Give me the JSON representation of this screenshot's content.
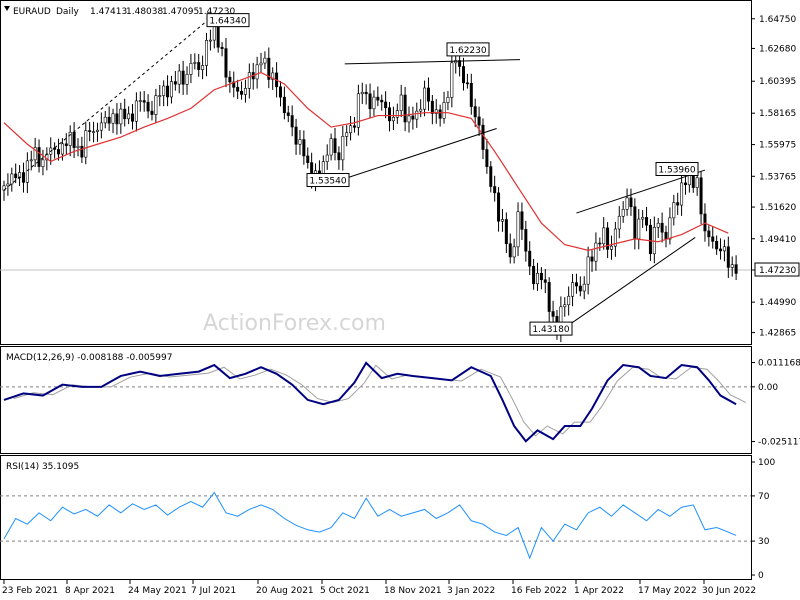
{
  "chart_data": {
    "type": "candlestick",
    "instrument": "EURAUD",
    "timeframe": "Daily",
    "ohlc": [
      "1.47413",
      "1.48038",
      "1.47095",
      "1.47230"
    ],
    "watermark": "ActionForex.com",
    "price_axis": [
      "1.64750",
      "1.62680",
      "1.60395",
      "1.58165",
      "1.55975",
      "1.53765",
      "1.51620",
      "1.49410",
      "1.47230",
      "1.44990",
      "1.42865"
    ],
    "last_price_label": "1.47230",
    "price_range": [
      1.4235,
      1.655
    ],
    "annotations": [
      {
        "text": "1.64340",
        "value": 1.6434
      },
      {
        "text": "1.62230",
        "value": 1.6223
      },
      {
        "text": "1.53540",
        "value": 1.5354
      },
      {
        "text": "1.53960",
        "value": 1.5396
      },
      {
        "text": "1.43180",
        "value": 1.4318
      }
    ],
    "price_series": [
      [
        0,
        1.528
      ],
      [
        4,
        1.54
      ],
      [
        8,
        1.535
      ],
      [
        12,
        1.545
      ],
      [
        16,
        1.555
      ],
      [
        20,
        1.545
      ],
      [
        24,
        1.56
      ],
      [
        28,
        1.552
      ],
      [
        32,
        1.565
      ],
      [
        36,
        1.56
      ],
      [
        40,
        1.555
      ],
      [
        44,
        1.572
      ],
      [
        48,
        1.568
      ],
      [
        52,
        1.58
      ],
      [
        56,
        1.575
      ],
      [
        60,
        1.583
      ],
      [
        64,
        1.576
      ],
      [
        68,
        1.588
      ],
      [
        72,
        1.59
      ],
      [
        76,
        1.58
      ],
      [
        80,
        1.6
      ],
      [
        84,
        1.594
      ],
      [
        88,
        1.608
      ],
      [
        92,
        1.603
      ],
      [
        96,
        1.617
      ],
      [
        100,
        1.612
      ],
      [
        104,
        1.627
      ],
      [
        108,
        1.643
      ],
      [
        112,
        1.62
      ],
      [
        116,
        1.603
      ],
      [
        120,
        1.595
      ],
      [
        124,
        1.6
      ],
      [
        128,
        1.61
      ],
      [
        132,
        1.618
      ],
      [
        136,
        1.612
      ],
      [
        140,
        1.6
      ],
      [
        144,
        1.585
      ],
      [
        148,
        1.57
      ],
      [
        152,
        1.56
      ],
      [
        156,
        1.545
      ],
      [
        160,
        1.535
      ],
      [
        164,
        1.548
      ],
      [
        168,
        1.56
      ],
      [
        172,
        1.552
      ],
      [
        176,
        1.57
      ],
      [
        180,
        1.575
      ],
      [
        184,
        1.602
      ],
      [
        188,
        1.585
      ],
      [
        192,
        1.595
      ],
      [
        196,
        1.582
      ],
      [
        200,
        1.578
      ],
      [
        204,
        1.59
      ],
      [
        208,
        1.575
      ],
      [
        212,
        1.582
      ],
      [
        216,
        1.595
      ],
      [
        220,
        1.585
      ],
      [
        224,
        1.578
      ],
      [
        228,
        1.598
      ],
      [
        232,
        1.622
      ],
      [
        236,
        1.605
      ],
      [
        240,
        1.59
      ],
      [
        244,
        1.57
      ],
      [
        248,
        1.545
      ],
      [
        252,
        1.52
      ],
      [
        256,
        1.505
      ],
      [
        260,
        1.478
      ],
      [
        264,
        1.51
      ],
      [
        268,
        1.488
      ],
      [
        272,
        1.462
      ],
      [
        276,
        1.472
      ],
      [
        280,
        1.445
      ],
      [
        284,
        1.432
      ],
      [
        288,
        1.45
      ],
      [
        292,
        1.462
      ],
      [
        296,
        1.458
      ],
      [
        300,
        1.475
      ],
      [
        304,
        1.49
      ],
      [
        308,
        1.496
      ],
      [
        312,
        1.488
      ],
      [
        316,
        1.51
      ],
      [
        320,
        1.523
      ],
      [
        324,
        1.5
      ],
      [
        328,
        1.51
      ],
      [
        332,
        1.49
      ],
      [
        336,
        1.505
      ],
      [
        340,
        1.495
      ],
      [
        344,
        1.518
      ],
      [
        348,
        1.528
      ],
      [
        352,
        1.539
      ],
      [
        356,
        1.53
      ],
      [
        360,
        1.5
      ],
      [
        364,
        1.49
      ],
      [
        368,
        1.488
      ],
      [
        372,
        1.478
      ],
      [
        376,
        1.472
      ]
    ],
    "moving_average": [
      [
        0,
        1.575
      ],
      [
        12,
        1.56
      ],
      [
        24,
        1.548
      ],
      [
        36,
        1.555
      ],
      [
        48,
        1.56
      ],
      [
        60,
        1.565
      ],
      [
        72,
        1.572
      ],
      [
        84,
        1.578
      ],
      [
        96,
        1.585
      ],
      [
        108,
        1.598
      ],
      [
        120,
        1.604
      ],
      [
        132,
        1.61
      ],
      [
        144,
        1.602
      ],
      [
        156,
        1.585
      ],
      [
        168,
        1.572
      ],
      [
        180,
        1.575
      ],
      [
        192,
        1.58
      ],
      [
        204,
        1.58
      ],
      [
        216,
        1.582
      ],
      [
        228,
        1.582
      ],
      [
        240,
        1.578
      ],
      [
        252,
        1.555
      ],
      [
        264,
        1.53
      ],
      [
        276,
        1.505
      ],
      [
        288,
        1.49
      ],
      [
        300,
        1.486
      ],
      [
        312,
        1.49
      ],
      [
        324,
        1.494
      ],
      [
        336,
        1.492
      ],
      [
        348,
        1.497
      ],
      [
        360,
        1.505
      ],
      [
        372,
        1.498
      ]
    ],
    "trendlines": [
      {
        "from": [
          175,
          1.616
        ],
        "to": [
          265,
          1.619
        ]
      },
      {
        "from": [
          175,
          1.536
        ],
        "to": [
          253,
          1.571
        ]
      },
      {
        "from": [
          294,
          1.512
        ],
        "to": [
          360,
          1.542
        ]
      },
      {
        "from": [
          288,
          1.432
        ],
        "to": [
          355,
          1.495
        ]
      }
    ],
    "macd": {
      "label": "MACD(12,26,9) -0.008188 -0.005997",
      "axis": [
        "0.011168",
        "0.00",
        "-0.025117"
      ],
      "range": [
        -0.029,
        0.016
      ],
      "macd_line": [
        [
          0,
          -0.006
        ],
        [
          10,
          -0.003
        ],
        [
          20,
          -0.004
        ],
        [
          30,
          0.001
        ],
        [
          40,
          0.0
        ],
        [
          50,
          0.0
        ],
        [
          60,
          0.005
        ],
        [
          70,
          0.007
        ],
        [
          80,
          0.005
        ],
        [
          90,
          0.006
        ],
        [
          100,
          0.007
        ],
        [
          108,
          0.01
        ],
        [
          116,
          0.004
        ],
        [
          124,
          0.006
        ],
        [
          132,
          0.009
        ],
        [
          140,
          0.006
        ],
        [
          148,
          0.001
        ],
        [
          156,
          -0.006
        ],
        [
          164,
          -0.008
        ],
        [
          172,
          -0.006
        ],
        [
          180,
          0.002
        ],
        [
          186,
          0.011
        ],
        [
          194,
          0.004
        ],
        [
          202,
          0.006
        ],
        [
          210,
          0.005
        ],
        [
          220,
          0.004
        ],
        [
          230,
          0.003
        ],
        [
          240,
          0.009
        ],
        [
          250,
          0.005
        ],
        [
          256,
          -0.006
        ],
        [
          262,
          -0.018
        ],
        [
          268,
          -0.025
        ],
        [
          274,
          -0.02
        ],
        [
          282,
          -0.024
        ],
        [
          288,
          -0.018
        ],
        [
          296,
          -0.018
        ],
        [
          302,
          -0.01
        ],
        [
          310,
          0.003
        ],
        [
          318,
          0.01
        ],
        [
          326,
          0.009
        ],
        [
          332,
          0.005
        ],
        [
          340,
          0.004
        ],
        [
          348,
          0.01
        ],
        [
          356,
          0.009
        ],
        [
          362,
          0.003
        ],
        [
          368,
          -0.004
        ],
        [
          376,
          -0.008
        ]
      ]
    },
    "rsi": {
      "label": "RSI(14) 35.1095",
      "axis": [
        "100",
        "70",
        "30",
        "0"
      ],
      "range": [
        0,
        100
      ],
      "levels": [
        70,
        30
      ],
      "rsi_line": [
        [
          0,
          32
        ],
        [
          6,
          50
        ],
        [
          12,
          45
        ],
        [
          18,
          55
        ],
        [
          24,
          48
        ],
        [
          30,
          60
        ],
        [
          36,
          54
        ],
        [
          42,
          58
        ],
        [
          48,
          52
        ],
        [
          54,
          62
        ],
        [
          60,
          55
        ],
        [
          66,
          63
        ],
        [
          72,
          58
        ],
        [
          78,
          62
        ],
        [
          84,
          53
        ],
        [
          90,
          60
        ],
        [
          96,
          65
        ],
        [
          102,
          60
        ],
        [
          108,
          73
        ],
        [
          114,
          55
        ],
        [
          120,
          52
        ],
        [
          126,
          58
        ],
        [
          132,
          62
        ],
        [
          138,
          58
        ],
        [
          144,
          50
        ],
        [
          150,
          44
        ],
        [
          156,
          40
        ],
        [
          162,
          38
        ],
        [
          168,
          42
        ],
        [
          174,
          55
        ],
        [
          180,
          50
        ],
        [
          186,
          68
        ],
        [
          192,
          52
        ],
        [
          198,
          58
        ],
        [
          204,
          52
        ],
        [
          210,
          55
        ],
        [
          216,
          58
        ],
        [
          222,
          50
        ],
        [
          228,
          55
        ],
        [
          234,
          62
        ],
        [
          240,
          48
        ],
        [
          246,
          45
        ],
        [
          252,
          38
        ],
        [
          258,
          35
        ],
        [
          264,
          42
        ],
        [
          270,
          15
        ],
        [
          276,
          42
        ],
        [
          282,
          30
        ],
        [
          288,
          45
        ],
        [
          294,
          40
        ],
        [
          300,
          55
        ],
        [
          306,
          60
        ],
        [
          312,
          52
        ],
        [
          318,
          62
        ],
        [
          324,
          55
        ],
        [
          330,
          48
        ],
        [
          336,
          58
        ],
        [
          342,
          52
        ],
        [
          348,
          60
        ],
        [
          354,
          62
        ],
        [
          360,
          40
        ],
        [
          366,
          42
        ],
        [
          372,
          38
        ],
        [
          376,
          35
        ]
      ]
    },
    "dates": [
      "23 Feb 2021",
      "8 Apr 2021",
      "24 May 2021",
      "7 Jul 2021",
      "20 Aug 2021",
      "5 Oct 2021",
      "18 Nov 2021",
      "3 Jan 2022",
      "16 Feb 2022",
      "1 Apr 2022",
      "17 May 2022",
      "30 Jun 2022"
    ]
  },
  "colors": {
    "candle": "#000000",
    "ma": "#e03030",
    "macd_line": "#000080",
    "macd_signal": "#a0a0a0",
    "rsi_line": "#1e90ff",
    "level_line": "#808080",
    "grid": "#c0c0c0"
  }
}
